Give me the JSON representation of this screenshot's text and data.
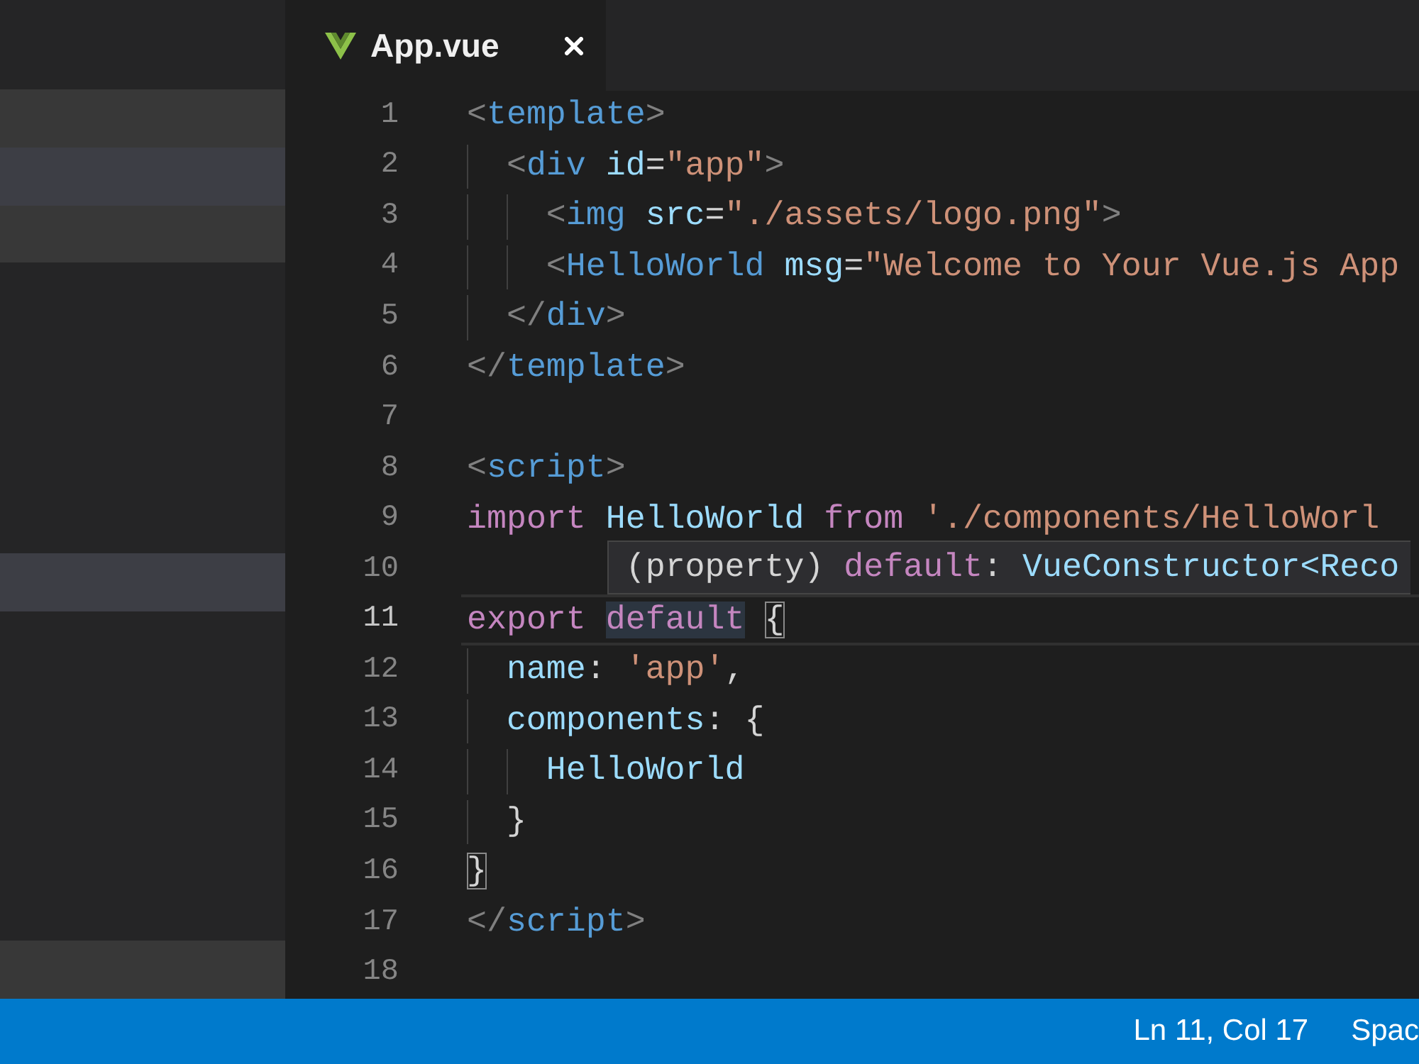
{
  "sidebar": {
    "groups": [
      {
        "rows": [
          {
            "selected": false
          },
          {
            "selected": true
          },
          {
            "selected": false
          }
        ]
      },
      {
        "rows": [
          {
            "selected": true
          }
        ]
      },
      {
        "rows": [
          {
            "selected": false
          }
        ]
      }
    ]
  },
  "tabs": [
    {
      "label": "App.vue",
      "selected": true
    }
  ],
  "editor": {
    "lines": [
      {
        "number": "1",
        "current": false,
        "tokens": [
          {
            "text": "<",
            "kind": "punct"
          },
          {
            "text": "template",
            "kind": "tag"
          },
          {
            "text": ">",
            "kind": "punct"
          }
        ],
        "children": [
          {
            "number": "2",
            "current": false,
            "tokens": [
              {
                "text": "<",
                "kind": "punct"
              },
              {
                "text": "div",
                "kind": "tag"
              },
              {
                "text": " id",
                "kind": "attr"
              },
              {
                "text": "=",
                "kind": "op"
              },
              {
                "text": "\"app\"",
                "kind": "string"
              },
              {
                "text": ">",
                "kind": "punct"
              }
            ],
            "children": [
              {
                "number": "3",
                "current": false,
                "tokens": [
                  {
                    "text": "<",
                    "kind": "punct"
                  },
                  {
                    "text": "img",
                    "kind": "tag"
                  },
                  {
                    "text": " src",
                    "kind": "attr"
                  },
                  {
                    "text": "=",
                    "kind": "op"
                  },
                  {
                    "text": "\"./assets/logo.png\"",
                    "kind": "string"
                  },
                  {
                    "text": ">",
                    "kind": "punct"
                  }
                ]
              },
              {
                "number": "4",
                "current": false,
                "tokens": [
                  {
                    "text": "<",
                    "kind": "punct"
                  },
                  {
                    "text": "HelloWorld",
                    "kind": "tag"
                  },
                  {
                    "text": " msg",
                    "kind": "attr"
                  },
                  {
                    "text": "=",
                    "kind": "op"
                  },
                  {
                    "text": "\"Welcome to Your Vue.js App",
                    "kind": "string"
                  }
                ]
              }
            ]
          },
          {
            "number": "5",
            "current": false,
            "tokens": [
              {
                "text": "</",
                "kind": "punct"
              },
              {
                "text": "div",
                "kind": "tag"
              },
              {
                "text": ">",
                "kind": "punct"
              }
            ]
          }
        ]
      },
      {
        "number": "6",
        "current": false,
        "tokens": [
          {
            "text": "</",
            "kind": "punct"
          },
          {
            "text": "template",
            "kind": "tag"
          },
          {
            "text": ">",
            "kind": "punct"
          }
        ]
      },
      {
        "number": "7",
        "current": false
      },
      {
        "number": "8",
        "current": false,
        "tokens": [
          {
            "text": "<",
            "kind": "punct"
          },
          {
            "text": "script",
            "kind": "tag"
          },
          {
            "text": ">",
            "kind": "punct"
          }
        ]
      },
      {
        "number": "9",
        "current": false,
        "tokens": [
          {
            "text": "import",
            "kind": "keyword"
          },
          {
            "text": " HelloWorld",
            "kind": "variable"
          },
          {
            "text": " from",
            "kind": "keyword"
          },
          {
            "text": " './components/HelloWorl",
            "kind": "string"
          }
        ]
      },
      {
        "number": "10",
        "current": false
      },
      {
        "number": "11",
        "current": true,
        "tokens": [
          {
            "text": "export",
            "kind": "keyword"
          },
          {
            "text": " default",
            "kind": "keyword",
            "highlighted": true,
            "tooltip": {
              "tokens": [
                {
                  "text": "(property) ",
                  "kind": "plain"
                },
                {
                  "text": "default",
                  "kind": "keyword"
                },
                {
                  "text": ": ",
                  "kind": "plain"
                },
                {
                  "text": "VueConstructor<Reco",
                  "kind": "type"
                }
              ]
            }
          },
          {
            "text": " {",
            "kind": "brace",
            "matched": true
          }
        ],
        "children": [
          {
            "number": "12",
            "current": false,
            "tokens": [
              {
                "text": "name",
                "kind": "variable"
              },
              {
                "text": ": ",
                "kind": "plain"
              },
              {
                "text": "'app'",
                "kind": "string"
              },
              {
                "text": ",",
                "kind": "plain"
              }
            ]
          },
          {
            "number": "13",
            "current": false,
            "tokens": [
              {
                "text": "components",
                "kind": "variable"
              },
              {
                "text": ": ",
                "kind": "plain"
              },
              {
                "text": "{",
                "kind": "brace"
              }
            ],
            "children": [
              {
                "number": "14",
                "current": false,
                "tokens": [
                  {
                    "text": "HelloWorld",
                    "kind": "variable"
                  }
                ]
              }
            ]
          },
          {
            "number": "15",
            "current": false,
            "tokens": [
              {
                "text": "}",
                "kind": "brace"
              }
            ]
          }
        ]
      },
      {
        "number": "16",
        "current": false,
        "tokens": [
          {
            "text": "}",
            "kind": "brace",
            "matched": true
          }
        ]
      },
      {
        "number": "17",
        "current": false,
        "tokens": [
          {
            "text": "</",
            "kind": "punct"
          },
          {
            "text": "script",
            "kind": "tag"
          },
          {
            "text": ">",
            "kind": "punct"
          }
        ]
      },
      {
        "number": "18",
        "current": false
      }
    ]
  },
  "status_bar": {
    "items": [
      "Ln 11, Col 17",
      "Spac"
    ]
  }
}
